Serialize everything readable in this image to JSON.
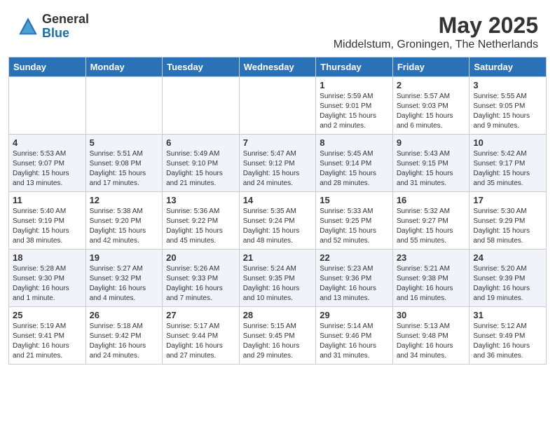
{
  "header": {
    "logo_general": "General",
    "logo_blue": "Blue",
    "month_year": "May 2025",
    "location": "Middelstum, Groningen, The Netherlands"
  },
  "days_of_week": [
    "Sunday",
    "Monday",
    "Tuesday",
    "Wednesday",
    "Thursday",
    "Friday",
    "Saturday"
  ],
  "weeks": [
    [
      {
        "day": "",
        "info": ""
      },
      {
        "day": "",
        "info": ""
      },
      {
        "day": "",
        "info": ""
      },
      {
        "day": "",
        "info": ""
      },
      {
        "day": "1",
        "info": "Sunrise: 5:59 AM\nSunset: 9:01 PM\nDaylight: 15 hours\nand 2 minutes."
      },
      {
        "day": "2",
        "info": "Sunrise: 5:57 AM\nSunset: 9:03 PM\nDaylight: 15 hours\nand 6 minutes."
      },
      {
        "day": "3",
        "info": "Sunrise: 5:55 AM\nSunset: 9:05 PM\nDaylight: 15 hours\nand 9 minutes."
      }
    ],
    [
      {
        "day": "4",
        "info": "Sunrise: 5:53 AM\nSunset: 9:07 PM\nDaylight: 15 hours\nand 13 minutes."
      },
      {
        "day": "5",
        "info": "Sunrise: 5:51 AM\nSunset: 9:08 PM\nDaylight: 15 hours\nand 17 minutes."
      },
      {
        "day": "6",
        "info": "Sunrise: 5:49 AM\nSunset: 9:10 PM\nDaylight: 15 hours\nand 21 minutes."
      },
      {
        "day": "7",
        "info": "Sunrise: 5:47 AM\nSunset: 9:12 PM\nDaylight: 15 hours\nand 24 minutes."
      },
      {
        "day": "8",
        "info": "Sunrise: 5:45 AM\nSunset: 9:14 PM\nDaylight: 15 hours\nand 28 minutes."
      },
      {
        "day": "9",
        "info": "Sunrise: 5:43 AM\nSunset: 9:15 PM\nDaylight: 15 hours\nand 31 minutes."
      },
      {
        "day": "10",
        "info": "Sunrise: 5:42 AM\nSunset: 9:17 PM\nDaylight: 15 hours\nand 35 minutes."
      }
    ],
    [
      {
        "day": "11",
        "info": "Sunrise: 5:40 AM\nSunset: 9:19 PM\nDaylight: 15 hours\nand 38 minutes."
      },
      {
        "day": "12",
        "info": "Sunrise: 5:38 AM\nSunset: 9:20 PM\nDaylight: 15 hours\nand 42 minutes."
      },
      {
        "day": "13",
        "info": "Sunrise: 5:36 AM\nSunset: 9:22 PM\nDaylight: 15 hours\nand 45 minutes."
      },
      {
        "day": "14",
        "info": "Sunrise: 5:35 AM\nSunset: 9:24 PM\nDaylight: 15 hours\nand 48 minutes."
      },
      {
        "day": "15",
        "info": "Sunrise: 5:33 AM\nSunset: 9:25 PM\nDaylight: 15 hours\nand 52 minutes."
      },
      {
        "day": "16",
        "info": "Sunrise: 5:32 AM\nSunset: 9:27 PM\nDaylight: 15 hours\nand 55 minutes."
      },
      {
        "day": "17",
        "info": "Sunrise: 5:30 AM\nSunset: 9:29 PM\nDaylight: 15 hours\nand 58 minutes."
      }
    ],
    [
      {
        "day": "18",
        "info": "Sunrise: 5:28 AM\nSunset: 9:30 PM\nDaylight: 16 hours\nand 1 minute."
      },
      {
        "day": "19",
        "info": "Sunrise: 5:27 AM\nSunset: 9:32 PM\nDaylight: 16 hours\nand 4 minutes."
      },
      {
        "day": "20",
        "info": "Sunrise: 5:26 AM\nSunset: 9:33 PM\nDaylight: 16 hours\nand 7 minutes."
      },
      {
        "day": "21",
        "info": "Sunrise: 5:24 AM\nSunset: 9:35 PM\nDaylight: 16 hours\nand 10 minutes."
      },
      {
        "day": "22",
        "info": "Sunrise: 5:23 AM\nSunset: 9:36 PM\nDaylight: 16 hours\nand 13 minutes."
      },
      {
        "day": "23",
        "info": "Sunrise: 5:21 AM\nSunset: 9:38 PM\nDaylight: 16 hours\nand 16 minutes."
      },
      {
        "day": "24",
        "info": "Sunrise: 5:20 AM\nSunset: 9:39 PM\nDaylight: 16 hours\nand 19 minutes."
      }
    ],
    [
      {
        "day": "25",
        "info": "Sunrise: 5:19 AM\nSunset: 9:41 PM\nDaylight: 16 hours\nand 21 minutes."
      },
      {
        "day": "26",
        "info": "Sunrise: 5:18 AM\nSunset: 9:42 PM\nDaylight: 16 hours\nand 24 minutes."
      },
      {
        "day": "27",
        "info": "Sunrise: 5:17 AM\nSunset: 9:44 PM\nDaylight: 16 hours\nand 27 minutes."
      },
      {
        "day": "28",
        "info": "Sunrise: 5:15 AM\nSunset: 9:45 PM\nDaylight: 16 hours\nand 29 minutes."
      },
      {
        "day": "29",
        "info": "Sunrise: 5:14 AM\nSunset: 9:46 PM\nDaylight: 16 hours\nand 31 minutes."
      },
      {
        "day": "30",
        "info": "Sunrise: 5:13 AM\nSunset: 9:48 PM\nDaylight: 16 hours\nand 34 minutes."
      },
      {
        "day": "31",
        "info": "Sunrise: 5:12 AM\nSunset: 9:49 PM\nDaylight: 16 hours\nand 36 minutes."
      }
    ]
  ]
}
